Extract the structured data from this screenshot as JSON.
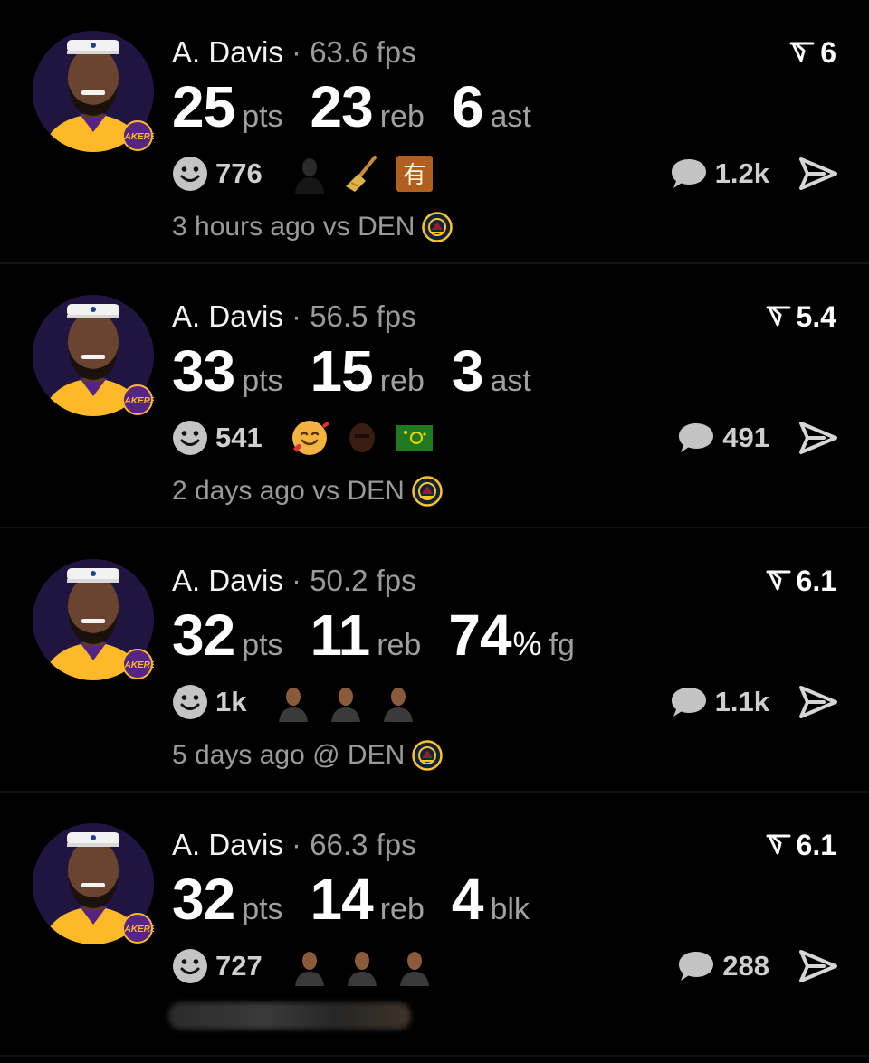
{
  "cards": [
    {
      "player": "A. Davis",
      "fps": "63.6 fps",
      "rating": "6",
      "stats": [
        {
          "value": "25",
          "pct": "",
          "unit": "pts"
        },
        {
          "value": "23",
          "pct": "",
          "unit": "reb"
        },
        {
          "value": "6",
          "pct": "",
          "unit": "ast"
        }
      ],
      "reactions": "776",
      "reaction_emojis": [
        "person-icon",
        "broom-icon",
        "kanji-you-icon"
      ],
      "comments": "1.2k",
      "time": "3 hours ago vs DEN"
    },
    {
      "player": "A. Davis",
      "fps": "56.5 fps",
      "rating": "5.4",
      "stats": [
        {
          "value": "33",
          "pct": "",
          "unit": "pts"
        },
        {
          "value": "15",
          "pct": "",
          "unit": "reb"
        },
        {
          "value": "3",
          "pct": "",
          "unit": "ast"
        }
      ],
      "reactions": "541",
      "reaction_emojis": [
        "smiling-face-hearts-icon",
        "face-photo-icon",
        "flag-icon"
      ],
      "comments": "491",
      "time": "2 days ago vs DEN"
    },
    {
      "player": "A. Davis",
      "fps": "50.2 fps",
      "rating": "6.1",
      "stats": [
        {
          "value": "32",
          "pct": "",
          "unit": "pts"
        },
        {
          "value": "11",
          "pct": "",
          "unit": "reb"
        },
        {
          "value": "74",
          "pct": "%",
          "unit": "fg"
        }
      ],
      "reactions": "1k",
      "reaction_emojis": [
        "person-photo-icon",
        "person-photo-icon",
        "person-photo-icon"
      ],
      "comments": "1.1k",
      "time": "5 days ago @ DEN"
    },
    {
      "player": "A. Davis",
      "fps": "66.3 fps",
      "rating": "6.1",
      "stats": [
        {
          "value": "32",
          "pct": "",
          "unit": "pts"
        },
        {
          "value": "14",
          "pct": "",
          "unit": "reb"
        },
        {
          "value": "4",
          "pct": "",
          "unit": "blk"
        }
      ],
      "reactions": "727",
      "reaction_emojis": [
        "person-photo-icon",
        "person-photo-icon",
        "person-photo-icon"
      ],
      "comments": "288",
      "time": ""
    }
  ],
  "colors": {
    "background": "#000000",
    "muted_text": "#9a9a9a",
    "lakers_purple": "#552583",
    "lakers_gold": "#fdb927",
    "nuggets_gold": "#fec524"
  }
}
